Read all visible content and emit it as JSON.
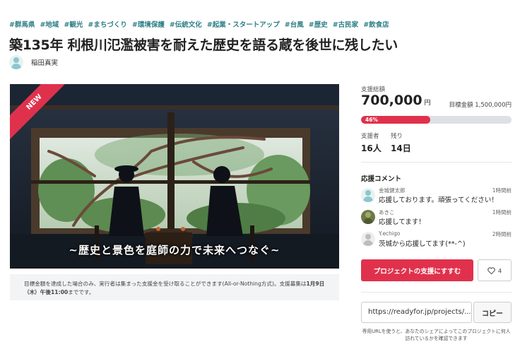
{
  "tags": [
    "#群馬県",
    "#地域",
    "#観光",
    "#まちづくり",
    "#環境保護",
    "#伝統文化",
    "#起業・スタートアップ",
    "#台風",
    "#歴史",
    "#古民家",
    "#飲食店"
  ],
  "project": {
    "title": "築135年 利根川氾濫被害を耐えた歴史を語る蔵を後世に残したい",
    "author": "稲田真実",
    "ribbon": "NEW",
    "hero_caption": "~歴史と景色を庭師の力で未来へつなぐ~",
    "notice_prefix": "目標金額を達成した場合のみ、実行者は集まった支援金を受け取ることができます(All-or-Nothing方式)。支援募集は",
    "notice_date": "1月9日（木）午後11:00",
    "notice_suffix": "までです。"
  },
  "funding": {
    "total_label": "支援総額",
    "total_amount": "700,000",
    "total_unit": "円",
    "goal_text": "目標金額 1,500,000円",
    "progress_percent": 46,
    "progress_label": "46%",
    "supporters_label": "支援者",
    "supporters_value": "16人",
    "remaining_label": "残り",
    "remaining_value": "14日"
  },
  "comments": {
    "title": "応援コメント",
    "items": [
      {
        "name": "金城健太郎",
        "time": "1時間前",
        "text": "応援しております。頑張ってください！",
        "avatar": "default"
      },
      {
        "name": "あきこ",
        "time": "1時間前",
        "text": "応援してます！",
        "avatar": "photo"
      },
      {
        "name": "Y.echigo",
        "time": "2時間前",
        "text": "茨城から応援してます(**-^)",
        "avatar": "gray"
      }
    ]
  },
  "actions": {
    "support_label": "プロジェクトの支援にすすむ",
    "favorite_count": "4"
  },
  "share": {
    "url": "https://readyfor.jp/projects/...",
    "copy_label": "コピー",
    "note": "専用URLを使うと、あなたのシェアによってこのプロジェクトに何人訪れているかを確認できます"
  },
  "colors": {
    "accent": "#e0314c",
    "tag": "#2e7f86"
  }
}
